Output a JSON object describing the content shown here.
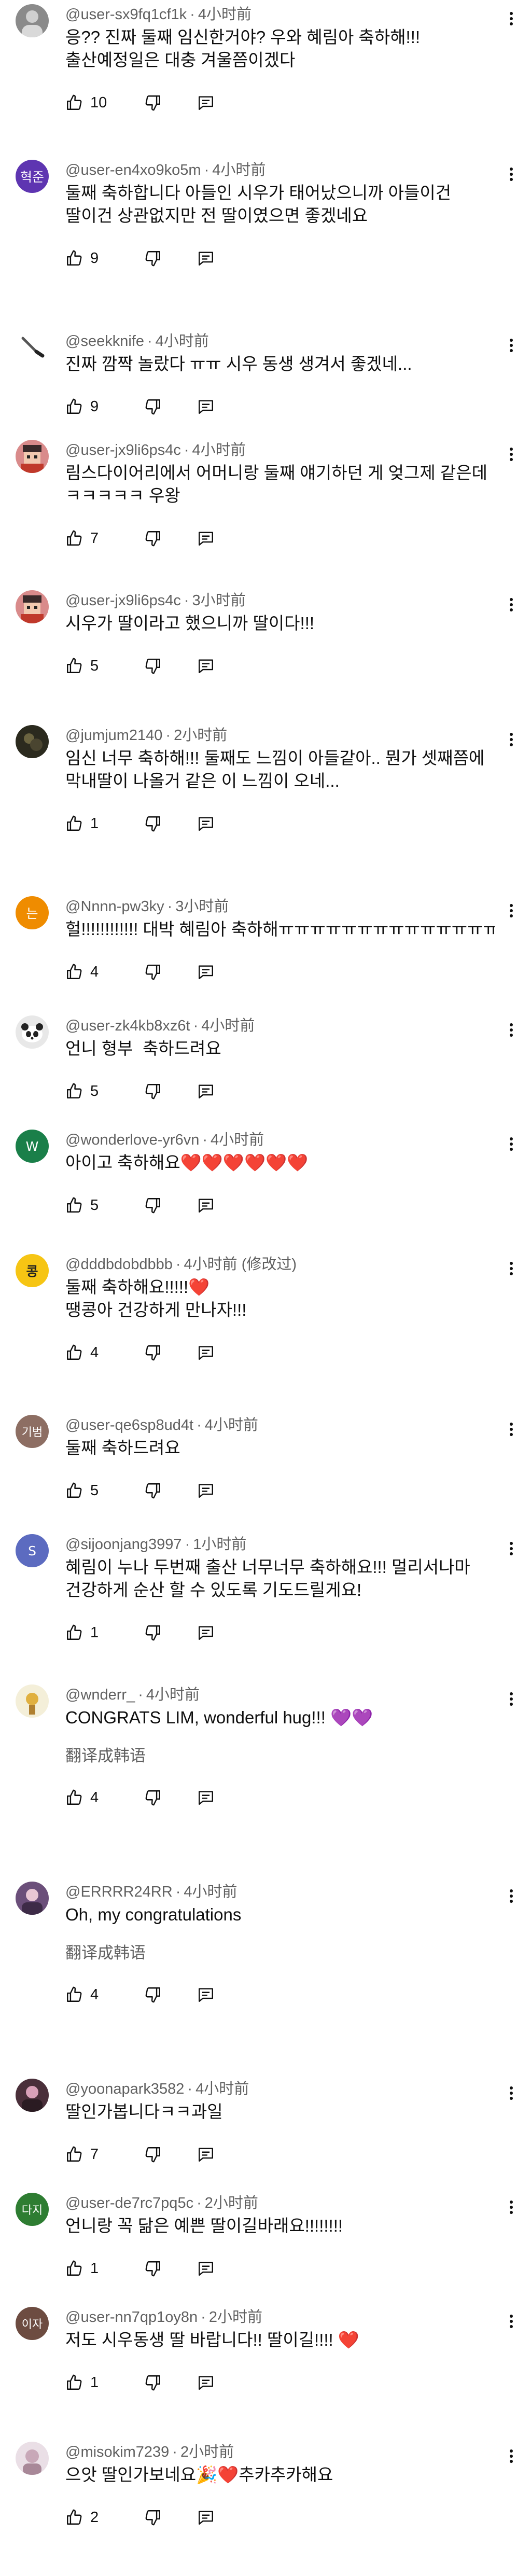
{
  "comments": [
    {
      "author": "@user-sx9fq1cf1k",
      "time": "4小时前",
      "text": "응?? 진짜 둘째 임신한거야? 우와 혜림아 축하해!!! 출산예정일은 대충 겨울쯤이겠다",
      "likes": "10",
      "avatar": {
        "type": "photo-gray",
        "color": "#8a8a8a"
      }
    },
    {
      "author": "@user-en4xo9ko5m",
      "time": "4小时前",
      "text": "둘째 축하합니다 아들인 시우가 태어났으니까 아들이건 딸이건 상관없지만 전 딸이였으면 좋겠네요",
      "likes": "9",
      "avatar": {
        "type": "letter",
        "letter": "혁준",
        "color": "#5e35b1"
      }
    },
    {
      "author": "@seekknife",
      "time": "4小时前",
      "text": "진짜 깜짝 놀랐다 ㅠㅠ 시우 동생 생겨서 좋겠네...",
      "likes": "9",
      "avatar": {
        "type": "photo-knife",
        "color": "#ffffff"
      }
    },
    {
      "author": "@user-jx9li6ps4c",
      "time": "4小时前",
      "text": "림스다이어리에서 어머니랑 둘째 얘기하던 게 엊그제 같은데 ㅋㅋㅋㅋㅋ 우왕",
      "likes": "7",
      "avatar": {
        "type": "photo-pixel",
        "color": "#d98b8b"
      }
    },
    {
      "author": "@user-jx9li6ps4c",
      "time": "3小时前",
      "text": "시우가 딸이라고 했으니까 딸이다!!!",
      "likes": "5",
      "avatar": {
        "type": "photo-pixel",
        "color": "#d98b8b"
      }
    },
    {
      "author": "@jumjum2140",
      "time": "2小时前",
      "text": "임신 너무 축하해!!! 둘째도 느낌이 아들같아.. 뭔가 셋째쯤에 막내딸이 나올거 같은 이 느낌이 오네...",
      "likes": "1",
      "avatar": {
        "type": "photo-dark",
        "color": "#2b2a1e"
      }
    },
    {
      "author": "@Nnnn-pw3ky",
      "time": "3小时前",
      "text": "헐!!!!!!!!!!!! 대박 혜림아 축하해ㅠㅠㅠㅠㅠㅠㅠㅠㅠㅠㅠㅠㅠㅠ",
      "likes": "4",
      "avatar": {
        "type": "letter",
        "letter": "는",
        "color": "#ef8c00"
      }
    },
    {
      "author": "@user-zk4kb8xz6t",
      "time": "4小时前",
      "text": "언니 형부  축하드려요",
      "likes": "5",
      "avatar": {
        "type": "photo-panda",
        "color": "#e8e8e8"
      }
    },
    {
      "author": "@wonderlove-yr6vn",
      "time": "4小时前",
      "text": "아이고 축하해요❤️❤️❤️❤️❤️❤️",
      "likes": "5",
      "avatar": {
        "type": "letter",
        "letter": "W",
        "color": "#1a7f49"
      }
    },
    {
      "author": "@dddbdobdbbb",
      "time": "4小时前 (修改过)",
      "text": "둘째 축하해요!!!!!❤️\n땡콩아 건강하게 만나자!!!",
      "likes": "4",
      "avatar": {
        "type": "letter-yellow",
        "letter": "콩",
        "color": "#f6c514"
      }
    },
    {
      "author": "@user-qe6sp8ud4t",
      "time": "4小时前",
      "text": "둘째 축하드려요",
      "likes": "5",
      "avatar": {
        "type": "letter",
        "letter": "기범",
        "color": "#8d6e63"
      }
    },
    {
      "author": "@sijoonjang3997",
      "time": "1小时前",
      "text": "혜림이 누나 두번째 출산 너무너무 축하해요!!! 멀리서나마 건강하게 순산 할 수 있도록 기도드릴게요!",
      "likes": "1",
      "avatar": {
        "type": "letter",
        "letter": "S",
        "color": "#5c6bc0"
      }
    },
    {
      "author": "@wnderr_",
      "time": "4小时前",
      "text": "CONGRATS LIM, wonderful hug!!! 💜💜",
      "likes": "4",
      "translate": "翻译成韩语",
      "avatar": {
        "type": "photo-light",
        "color": "#f4efd9"
      }
    },
    {
      "author": "@ERRRR24RR",
      "time": "4小时前",
      "text": "Oh, my congratulations",
      "likes": "4",
      "translate": "翻译成韩语",
      "avatar": {
        "type": "photo-purple",
        "color": "#6b4f7a"
      }
    },
    {
      "author": "@yoonapark3582",
      "time": "4小时前",
      "text": "딸인가봅니다ㅋㅋ과일",
      "likes": "7",
      "avatar": {
        "type": "photo-purple",
        "color": "#4a2f3a"
      }
    },
    {
      "author": "@user-de7rc7pq5c",
      "time": "2小时前",
      "text": "언니랑 꼭 닮은 예쁜 딸이길바래요!!!!!!!!",
      "likes": "1",
      "avatar": {
        "type": "letter",
        "letter": "다지",
        "color": "#2e7d32"
      }
    },
    {
      "author": "@user-nn7qp1oy8n",
      "time": "2小时前",
      "text": "저도 시우동생 딸 바랍니다!! 딸이길!!!! ❤️",
      "likes": "1",
      "avatar": {
        "type": "letter",
        "letter": "이자",
        "color": "#6d4c41"
      }
    },
    {
      "author": "@misokim7239",
      "time": "2小时前",
      "text": "으앗 딸인가보네요🎉❤️추카추카해요",
      "likes": "2",
      "avatar": {
        "type": "photo-light",
        "color": "#eadfe6"
      }
    }
  ]
}
